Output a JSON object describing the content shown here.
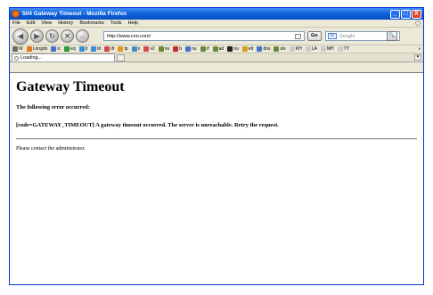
{
  "window": {
    "title": "504 Gateway Timeout - Mozilla Firefox",
    "minimize": "_",
    "maximize": "□",
    "close": "X"
  },
  "menu": [
    "File",
    "Edit",
    "View",
    "History",
    "Bookmarks",
    "Tools",
    "Help"
  ],
  "nav": {
    "back": "◀",
    "forward": "▶",
    "reload": "↻",
    "stop": "✕",
    "home": "⌂",
    "url": "http://www.cnn.com/",
    "go_label": "Go",
    "search_placeholder": "Google",
    "search_engine": "G",
    "search_button": "🔍"
  },
  "bookmarks": [
    {
      "label": "W",
      "color": "#6a6a6a"
    },
    {
      "label": "Longdo",
      "color": "#e8741c"
    },
    {
      "label": "ic",
      "color": "#4a6fd4"
    },
    {
      "label": "eq",
      "color": "#2b9a3c"
    },
    {
      "label": "it",
      "color": "#3a8fd0"
    },
    {
      "label": "td",
      "color": "#3a8fd0"
    },
    {
      "label": "dt",
      "color": "#d44a4a"
    },
    {
      "label": "tp",
      "color": "#e8941c"
    },
    {
      "label": "n",
      "color": "#3a8fd0"
    },
    {
      "label": "v2",
      "color": "#d44a4a"
    },
    {
      "label": "nu",
      "color": "#6a8a3a"
    },
    {
      "label": "b",
      "color": "#c42b2b"
    },
    {
      "label": "nu",
      "color": "#4a6fd4"
    },
    {
      "label": "rf",
      "color": "#6a8a3a"
    },
    {
      "label": "ad",
      "color": "#6a8a3a"
    },
    {
      "label": "nu",
      "color": "#222222"
    },
    {
      "label": "ett",
      "color": "#d4a01c"
    },
    {
      "label": "dns",
      "color": "#4a6fd4"
    },
    {
      "label": "stv",
      "color": "#6a8a3a"
    },
    {
      "label": "KH",
      "color": "#cccccc"
    },
    {
      "label": "LA",
      "color": "#cccccc"
    },
    {
      "label": "MH",
      "color": "#cccccc"
    },
    {
      "label": "TY",
      "color": "#cccccc"
    }
  ],
  "bookmarks_more": "»",
  "tab": {
    "label": "Loading...",
    "menu": "▾"
  },
  "page": {
    "heading": "Gateway Timeout",
    "error_intro": "The following error occurred:",
    "error_detail": "[code=GATEWAY_TIMEOUT] A gateway timeout occurred. The server is unreachable. Retry the request.",
    "contact": "Please contact the administrator."
  }
}
